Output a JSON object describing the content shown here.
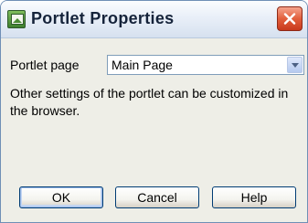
{
  "window": {
    "title": "Portlet Properties",
    "icon": "app-icon",
    "close_icon": "close-icon"
  },
  "form": {
    "portlet_page_label": "Portlet page",
    "portlet_page_value": "Main Page",
    "info_text": "Other settings of the portlet can be customized in the browser."
  },
  "buttons": {
    "ok_label": "OK",
    "cancel_label": "Cancel",
    "help_label": "Help"
  },
  "colors": {
    "close_button": "#e25f3c",
    "dialog_background": "#eeeee7",
    "button_border": "#003c74"
  }
}
